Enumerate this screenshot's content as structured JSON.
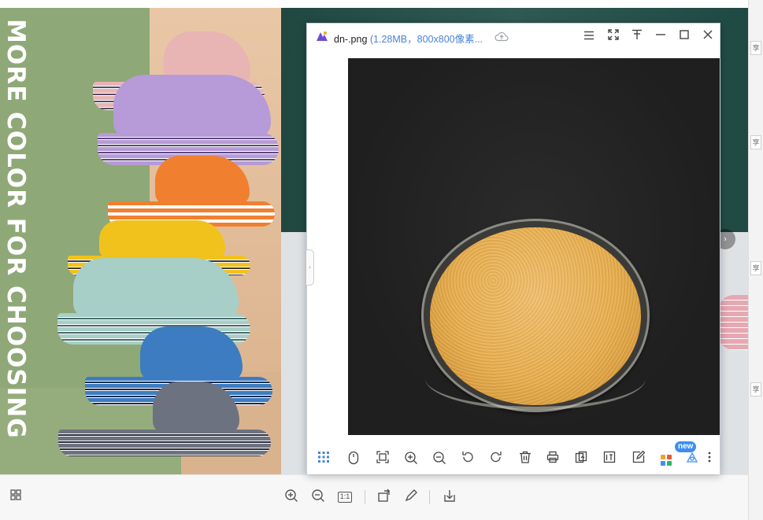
{
  "background_viewer": {
    "product_text": "MORE COLOR FOR CHOOSING",
    "next_arrow": "›",
    "edge_tabs": [
      "享",
      "享",
      "享",
      "享"
    ],
    "toolbar": {
      "grid": "grid-icon",
      "zoom_in": "zoom-in-icon",
      "zoom_out": "zoom-out-icon",
      "actual_size": "1:1",
      "rotate": "rotate-icon",
      "edit": "edit-icon",
      "download": "download-icon"
    }
  },
  "viewer_window": {
    "file_name": "dn-.png",
    "file_info": "(1.28MB，800x800像素...",
    "side_handle": "‹",
    "window_controls": {
      "menu": "menu-icon",
      "fullscreen": "fullscreen-icon",
      "pin": "pin-icon",
      "minimize": "minimize-icon",
      "maximize": "maximize-icon",
      "close": "close-icon"
    },
    "badge": "new",
    "toolbar": [
      "thumbnails-icon",
      "mouse-icon",
      "fit-screen-icon",
      "zoom-in-icon",
      "zoom-out-icon",
      "rotate-left-icon",
      "rotate-right-icon",
      "delete-icon",
      "print-icon",
      "convert-icon",
      "extract-text-icon",
      "edit-icon",
      "apps-icon",
      "cutout-icon",
      "more-icon"
    ]
  },
  "colors": {
    "accent": "#4a84d6",
    "badge": "#3d8ff3"
  }
}
